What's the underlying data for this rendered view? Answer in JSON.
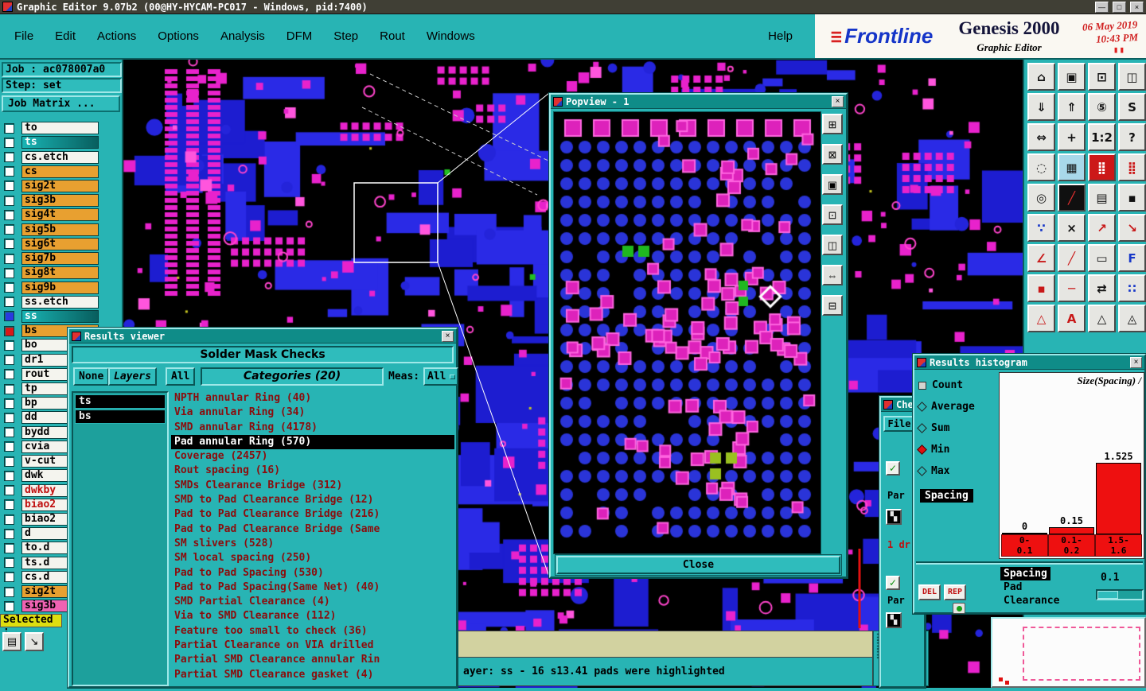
{
  "titlebar": {
    "title": "Graphic Editor 9.07b2 (00@HY-HYCAM-PC017 - Windows, pid:7400)",
    "minimize_glyph": "—",
    "maximize_glyph": "□",
    "close_glyph": "×"
  },
  "menubar": {
    "items": [
      {
        "label": "File"
      },
      {
        "label": "Edit"
      },
      {
        "label": "Actions"
      },
      {
        "label": "Options"
      },
      {
        "label": "Analysis"
      },
      {
        "label": "DFM"
      },
      {
        "label": "Step"
      },
      {
        "label": "Rout"
      },
      {
        "label": "Windows"
      }
    ],
    "help_label": "Help"
  },
  "branding": {
    "logo_bars_glyph": "≡",
    "logo_text": "Frontline",
    "product": "Genesis 2000",
    "date": "06 May 2019",
    "time": "10:43 PM",
    "subtitle": "Graphic Editor",
    "pause_glyph": "▮▮"
  },
  "sidebar": {
    "job_field": "Job : ac078007a0",
    "step_field": "Step: set",
    "job_matrix_label": "Job Matrix ...",
    "selected_label": "Selected :",
    "layers": [
      {
        "name": "to",
        "style": "plain",
        "box": "#ffffff"
      },
      {
        "name": "ts",
        "style": "active",
        "box": "#ffffff"
      },
      {
        "name": "cs.etch",
        "style": "plain",
        "box": "#ffffff"
      },
      {
        "name": "cs",
        "style": "signal",
        "box": "#ffffff"
      },
      {
        "name": "sig2t",
        "style": "signal",
        "box": "#ffffff"
      },
      {
        "name": "sig3b",
        "style": "signal",
        "box": "#ffffff"
      },
      {
        "name": "sig4t",
        "style": "signal",
        "box": "#ffffff"
      },
      {
        "name": "sig5b",
        "style": "signal",
        "box": "#ffffff"
      },
      {
        "name": "sig6t",
        "style": "signal",
        "box": "#ffffff"
      },
      {
        "name": "sig7b",
        "style": "signal",
        "box": "#ffffff"
      },
      {
        "name": "sig8t",
        "style": "signal",
        "box": "#ffffff"
      },
      {
        "name": "sig9b",
        "style": "signal",
        "box": "#ffffff"
      },
      {
        "name": "ss.etch",
        "style": "plain",
        "box": "#ffffff"
      },
      {
        "name": "ss",
        "style": "active",
        "box": "#2a3ae0"
      },
      {
        "name": "bs",
        "style": "signal",
        "box": "#d81818"
      },
      {
        "name": "bo",
        "style": "plain",
        "box": "#ffffff"
      },
      {
        "name": "dr1",
        "style": "plain",
        "box": "#ffffff"
      },
      {
        "name": "rout",
        "style": "plain",
        "box": "#ffffff"
      },
      {
        "name": "tp",
        "style": "plain",
        "box": "#ffffff"
      },
      {
        "name": "bp",
        "style": "plain",
        "box": "#ffffff"
      },
      {
        "name": "dd",
        "style": "plain",
        "box": "#ffffff"
      },
      {
        "name": "bydd",
        "style": "plain",
        "box": "#ffffff"
      },
      {
        "name": "cvia",
        "style": "plain",
        "box": "#ffffff"
      },
      {
        "name": "v-cut",
        "style": "plain",
        "box": "#ffffff"
      },
      {
        "name": "dwk",
        "style": "plain",
        "box": "#ffffff"
      },
      {
        "name": "dwkby",
        "style": "alert",
        "box": "#ffffff"
      },
      {
        "name": "biao2",
        "style": "alert",
        "box": "#ffffff"
      },
      {
        "name": "biao2",
        "style": "plain",
        "box": "#ffffff"
      },
      {
        "name": "d",
        "style": "plain",
        "box": "#ffffff"
      },
      {
        "name": "to.d",
        "style": "plain",
        "box": "#ffffff"
      },
      {
        "name": "ts.d",
        "style": "plain",
        "box": "#ffffff"
      },
      {
        "name": "cs.d",
        "style": "plain",
        "box": "#ffffff"
      },
      {
        "name": "sig2t",
        "style": "signal",
        "box": "#ffffff"
      },
      {
        "name": "sig3b",
        "style": "pink",
        "box": "#ffffff"
      }
    ],
    "bottom_buttons": [
      {
        "name": "matrix-edit-icon",
        "glyph": "▤"
      },
      {
        "name": "pick-arrow-icon",
        "glyph": "↘"
      }
    ]
  },
  "toolbar": {
    "icons": [
      {
        "name": "home-view-icon",
        "glyph": "⌂"
      },
      {
        "name": "screen-view-icon",
        "glyph": "▣"
      },
      {
        "name": "zoom-window-icon",
        "glyph": "⊡"
      },
      {
        "name": "split-view-icon",
        "glyph": "◫"
      },
      {
        "name": "import-view-icon",
        "glyph": "⇓"
      },
      {
        "name": "export-view-icon",
        "glyph": "⇑"
      },
      {
        "name": "five-panel-icon",
        "glyph": "⑤"
      },
      {
        "name": "snap-icon",
        "glyph": "S"
      },
      {
        "name": "fit-all-icon",
        "glyph": "⇔"
      },
      {
        "name": "pan-icon",
        "glyph": "+"
      },
      {
        "name": "zoom-ratio-icon",
        "glyph": "1:2"
      },
      {
        "name": "help-tool-icon",
        "glyph": "?"
      },
      {
        "name": "lasso-icon",
        "glyph": "◌"
      },
      {
        "name": "grid-icon",
        "glyph": "▦",
        "bg": "#a8d8ea"
      },
      {
        "name": "highlight-pads-icon",
        "glyph": "⣿",
        "bg": "#cc1818",
        "fg": "#ffffff"
      },
      {
        "name": "pattern-icon",
        "glyph": "⣿",
        "fg": "#cc1818"
      },
      {
        "name": "origin-icon",
        "glyph": "◎"
      },
      {
        "name": "arc-icon",
        "glyph": "╱",
        "bg": "#101010",
        "fg": "#e83030"
      },
      {
        "name": "ruler-icon",
        "glyph": "▤"
      },
      {
        "name": "dot-icon",
        "glyph": "▪"
      },
      {
        "name": "net-points-icon",
        "glyph": "∵",
        "fg": "#1838c8"
      },
      {
        "name": "delete-icon",
        "glyph": "×"
      },
      {
        "name": "vector-up-icon",
        "glyph": "↗",
        "fg": "#c81818"
      },
      {
        "name": "vector-down-icon",
        "glyph": "↘",
        "fg": "#c81818"
      },
      {
        "name": "angle-icon",
        "glyph": "∠",
        "fg": "#c81818"
      },
      {
        "name": "line-icon",
        "glyph": "╱",
        "fg": "#c81818"
      },
      {
        "name": "rect-icon",
        "glyph": "▭"
      },
      {
        "name": "flip-icon",
        "glyph": "F",
        "fg": "#1838c8"
      },
      {
        "name": "corner-icon",
        "glyph": "▪",
        "fg": "#c81818"
      },
      {
        "name": "segment-icon",
        "glyph": "─",
        "fg": "#c81818"
      },
      {
        "name": "transform-icon",
        "glyph": "⇄"
      },
      {
        "name": "cluster-icon",
        "glyph": "∷",
        "fg": "#1838c8"
      },
      {
        "name": "triangle-icon",
        "glyph": "△",
        "fg": "#c81818"
      },
      {
        "name": "text-a-icon",
        "glyph": "A",
        "fg": "#c81818"
      },
      {
        "name": "triangle-outline-icon",
        "glyph": "△"
      },
      {
        "name": "triangle-dot-icon",
        "glyph": "◬"
      }
    ]
  },
  "popview": {
    "title": "Popview - 1",
    "close_glyph": "×",
    "close_label": "Close",
    "tools": [
      {
        "name": "grid-settings-icon",
        "glyph": "⊞"
      },
      {
        "name": "capture-icon",
        "glyph": "⊠"
      },
      {
        "name": "display-icon",
        "glyph": "▣"
      },
      {
        "name": "zoom-area-icon",
        "glyph": "⊡"
      },
      {
        "name": "split-pane-icon",
        "glyph": "◫"
      },
      {
        "name": "fit-width-icon",
        "glyph": "⇔"
      },
      {
        "name": "collapse-icon",
        "glyph": "⊟"
      }
    ]
  },
  "results_viewer": {
    "title": "Results viewer",
    "close_glyph": "×",
    "header": "Solder Mask Checks",
    "none_label": "None",
    "layers_label": "Layers",
    "all_label": "All",
    "categories_header": "Categories (20)",
    "meas_label": "Meas:",
    "meas_value": "All",
    "layer_items": [
      {
        "label": "ts"
      },
      {
        "label": "bs"
      }
    ],
    "categories": [
      {
        "label": "NPTH annular Ring (40)"
      },
      {
        "label": "Via annular Ring (34)"
      },
      {
        "label": "SMD annular Ring (4178)"
      },
      {
        "label": "Pad annular Ring (570)",
        "state": "selected"
      },
      {
        "label": "Coverage (2457)"
      },
      {
        "label": "Rout spacing (16)"
      },
      {
        "label": "SMDs Clearance Bridge (312)"
      },
      {
        "label": "SMD to Pad Clearance Bridge (12)"
      },
      {
        "label": "Pad to Pad Clearance Bridge (216)"
      },
      {
        "label": "Pad to Pad Clearance Bridge (Same"
      },
      {
        "label": "SM slivers (528)"
      },
      {
        "label": "SM local spacing (250)"
      },
      {
        "label": "Pad to Pad Spacing (530)"
      },
      {
        "label": "Pad to Pad Spacing(Same Net) (40)"
      },
      {
        "label": "SMD Partial Clearance (4)"
      },
      {
        "label": "Via to SMD Clearance (112)"
      },
      {
        "label": "Feature too small to check (36)"
      },
      {
        "label": "Partial Clearance on VIA drilled"
      },
      {
        "label": "Partial SMD Clearance annular Rin"
      },
      {
        "label": "Partial SMD Clearance gasket (4)"
      }
    ]
  },
  "histogram": {
    "title": "Results histogram",
    "close_glyph": "×",
    "stats": [
      {
        "label": "Count",
        "marker": "square"
      },
      {
        "label": "Average",
        "marker": "diamond"
      },
      {
        "label": "Sum",
        "marker": "diamond"
      },
      {
        "label": "Min",
        "marker": "diamond-red"
      },
      {
        "label": "Max",
        "marker": "diamond"
      }
    ],
    "param_tag": "Spacing",
    "measures": [
      {
        "label": "Spacing",
        "state": "selected"
      },
      {
        "label": "Pad Clearance"
      }
    ],
    "value": "0.1",
    "del_label": "DEL",
    "rep_label": "REP"
  },
  "chart_data": {
    "type": "bar",
    "title": "Size(Spacing) /",
    "categories": [
      "0-0.1",
      "0.1-0.2",
      "1.5-1.6"
    ],
    "values": [
      0,
      0.15,
      1.525
    ],
    "bar_color": "#ee1010",
    "legend_position": "none",
    "grid": false
  },
  "checklist": {
    "title": "Che",
    "file_label": "File",
    "check_glyph": "✓",
    "par1_label": "Par",
    "drill_label": "1 dr",
    "par2_label": "Par",
    "action_glyph": "▚"
  },
  "statusbar": {
    "message": "ayer: ss - 16 s13.41 pads were highlighted",
    "help_glyph": "?"
  }
}
